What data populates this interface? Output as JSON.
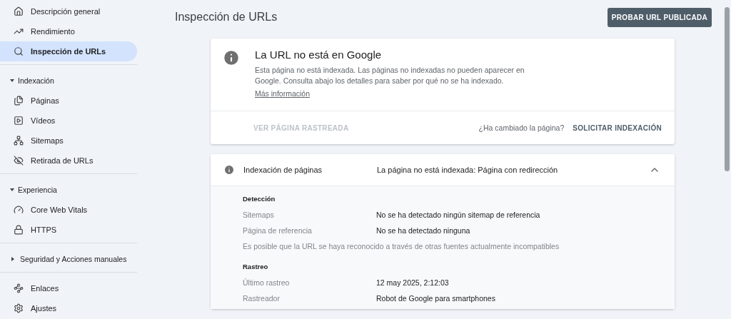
{
  "sidebar": {
    "groups": [
      {
        "items": [
          {
            "label": "Descripción general",
            "selected": false
          },
          {
            "label": "Rendimiento",
            "selected": false
          },
          {
            "label": "Inspección de URLs",
            "selected": true
          }
        ]
      },
      {
        "title": "Indexación",
        "expanded": true,
        "items": [
          {
            "label": "Páginas",
            "selected": false
          },
          {
            "label": "Vídeos",
            "selected": false
          },
          {
            "label": "Sitemaps",
            "selected": false
          },
          {
            "label": "Retirada de URLs",
            "selected": false
          }
        ]
      },
      {
        "title": "Experiencia",
        "expanded": true,
        "items": [
          {
            "label": "Core Web Vitals",
            "selected": false
          },
          {
            "label": "HTTPS",
            "selected": false
          }
        ]
      },
      {
        "title": "Seguridad y Acciones manuales",
        "expanded": false
      },
      {
        "items": [
          {
            "label": "Enlaces",
            "selected": false
          },
          {
            "label": "Ajustes",
            "selected": false
          }
        ]
      }
    ]
  },
  "page": {
    "title": "Inspección de URLs",
    "action_button": "PROBAR URL PUBLICADA"
  },
  "status_card": {
    "title": "La URL no está en Google",
    "description": "Esta página no está indexada. Las páginas no indexadas no pueden aparecer en Google. Consulta abajo los detalles para saber por qué no se ha indexado.",
    "link": "Más información",
    "view_button": {
      "label": "VER PÁGINA RASTREADA",
      "disabled": true
    },
    "question": "¿Ha cambiado la página?",
    "request_button": "SOLICITAR INDEXACIÓN"
  },
  "detail_card": {
    "title": "Indexación de páginas",
    "summary": "La página no está indexada: Página con redirección",
    "expanded": true,
    "sections": [
      {
        "title": "Detección",
        "rows": [
          {
            "kind": "pair",
            "label": "Sitemaps",
            "value": "No se ha detectado ningún sitemap de referencia"
          },
          {
            "kind": "pair",
            "label": "Página de referencia",
            "value": "No se ha detectado ninguna"
          },
          {
            "kind": "note",
            "label": "Es posible que la URL se haya reconocido a través de otras fuentes actualmente incompatibles"
          }
        ]
      },
      {
        "title": "Rastreo",
        "rows": [
          {
            "kind": "pair",
            "label": "Último rastreo",
            "value": "12 may 2025, 2:12:03"
          },
          {
            "kind": "pair",
            "label": "Rastreador",
            "value": "Robot de Google para smartphones"
          }
        ]
      }
    ]
  }
}
